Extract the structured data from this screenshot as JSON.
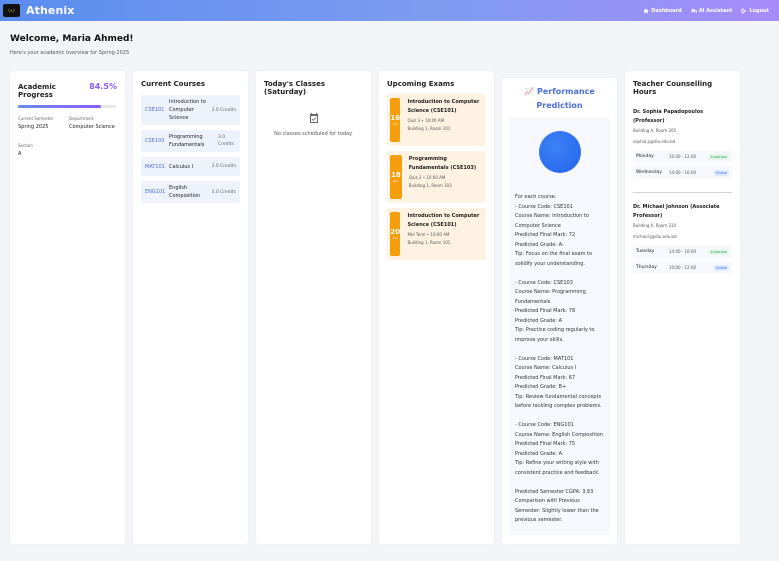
{
  "app": {
    "logo_text": "(+)",
    "title": "Athenix"
  },
  "nav": [
    {
      "label": "Dashboard",
      "icon": "home-icon"
    },
    {
      "label": "AI Assistant",
      "icon": "chat-icon"
    },
    {
      "label": "Logout",
      "icon": "logout-icon"
    }
  ],
  "welcome": {
    "title": "Welcome, Maria Ahmed!",
    "subtitle": "Here's your academic overview for Spring 2025"
  },
  "progress": {
    "title": "Academic Progress",
    "percent_label": "84.5%",
    "percent": 0.845,
    "semester_label": "Current Semester",
    "semester": "Spring 2025",
    "department_label": "Department",
    "department": "Computer Science",
    "section_label": "Section",
    "section": "A"
  },
  "courses": {
    "title": "Current Courses",
    "items": [
      {
        "code": "CSE101",
        "name": "Introduction to Computer Science",
        "credits": "3.0 Credits"
      },
      {
        "code": "CSE103",
        "name": "Programming Fundamentals",
        "credits": "3.0 Credits"
      },
      {
        "code": "MAT101",
        "name": "Calculus I",
        "credits": "3.0 Credits"
      },
      {
        "code": "ENG101",
        "name": "English Composition",
        "credits": "3.0 Credits"
      }
    ]
  },
  "classes": {
    "title": "Today's Classes (Saturday)",
    "empty_text": "No classes scheduled for today."
  },
  "exams": {
    "title": "Upcoming Exams",
    "items": [
      {
        "day": "16",
        "month": "Jun",
        "title": "Introduction to Computer Science (CSE101)",
        "detail": "Quiz 3 • 10:00 AM",
        "location": "Building 1, Room 101"
      },
      {
        "day": "18",
        "month": "Jun",
        "title": "Programming Fundamentals (CSE103)",
        "detail": "Quiz 2 • 10:00 AM",
        "location": "Building 1, Room 103"
      },
      {
        "day": "20",
        "month": "Jun",
        "title": "Introduction to Computer Science (CSE101)",
        "detail": "Mid Term • 10:00 AM",
        "location": "Building 1, Room 101"
      }
    ]
  },
  "performance": {
    "title": "📈 Performance Prediction",
    "text": "For each course:\n- Course Code: CSE101\nCourse Name: Introduction to Computer Science\nPredicted Final Mark: 72\nPredicted Grade: A-\nTip: Focus on the final exam to solidify your understanding.\n\n- Course Code: CSE103\nCourse Name: Programming Fundamentals\nPredicted Final Mark: 78\nPredicted Grade: A\nTip: Practice coding regularly to improve your skills.\n\n- Course Code: MAT101\nCourse Name: Calculus I\nPredicted Final Mark: 67\nPredicted Grade: B+\nTip: Review fundamental concepts before tackling complex problems.\n\n- Course Code: ENG101\nCourse Name: English Composition\nPredicted Final Mark: 75\nPredicted Grade: A\nTip: Refine your writing style with consistent practice and feedback.\n\nPredicted Semester CGPA: 3.63\nComparison with Previous Semester: Slightly lower than the previous semester."
  },
  "counselling": {
    "title": "Teacher Counselling Hours",
    "teachers": [
      {
        "name": "Dr. Sophia Papadopoulos (Professor)",
        "office": "Building A, Room 205",
        "email": "sophia.p@diu.edu.bd",
        "slots": [
          {
            "day": "Monday",
            "time": "10:00 - 12:00",
            "mode": "In-person",
            "mode_type": "in"
          },
          {
            "day": "Wednesday",
            "time": "14:00 - 16:00",
            "mode": "Online",
            "mode_type": "on"
          }
        ]
      },
      {
        "name": "Dr. Michael Johnson (Associate Professor)",
        "office": "Building A, Room 210",
        "email": "michael.j@diu.edu.bd",
        "slots": [
          {
            "day": "Tuesday",
            "time": "14:00 - 16:00",
            "mode": "In-person",
            "mode_type": "in"
          },
          {
            "day": "Thursday",
            "time": "10:00 - 12:00",
            "mode": "Online",
            "mode_type": "on"
          }
        ]
      }
    ]
  },
  "colors": {
    "accent": "#4c6fe0",
    "progress": "#8b5cf6",
    "exam": "#f59e0b"
  }
}
